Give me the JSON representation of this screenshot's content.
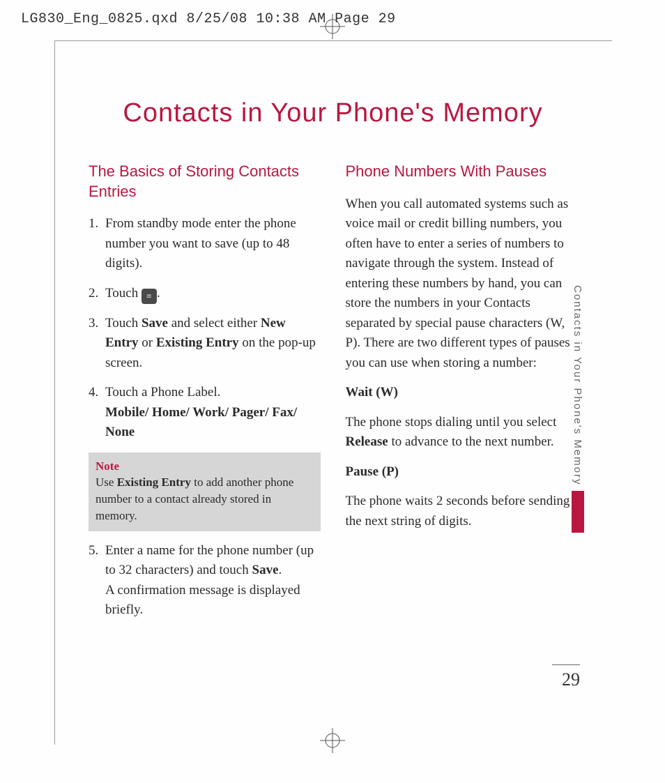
{
  "slug": "LG830_Eng_0825.qxd  8/25/08  10:38 AM  Page 29",
  "title": "Contacts in Your Phone's Memory",
  "left": {
    "heading": "The Basics of Storing Contacts Entries",
    "steps": {
      "s1": "From standby mode enter the phone number you want to save (up to 48 digits).",
      "s2a": "Touch ",
      "s2b": ".",
      "s3a": "Touch ",
      "s3_save": "Save",
      "s3b": " and select either ",
      "s3_new": "New Entry",
      "s3c": " or ",
      "s3_exist": "Existing Entry",
      "s3d": " on the pop-up screen.",
      "s4a": "Touch a Phone Label.",
      "s4b": "Mobile/ Home/ Work/ Pager/ Fax/ None",
      "s5a": "Enter a name for the phone number (up to 32 characters) and touch ",
      "s5_save": "Save",
      "s5b": ".",
      "s5c": "A confirmation message is displayed briefly."
    },
    "note": {
      "label": "Note",
      "a": "Use ",
      "bold": "Existing Entry",
      "b": " to add another phone number to a contact already stored in memory."
    }
  },
  "right": {
    "heading": "Phone Numbers With Pauses",
    "intro": "When you call automated systems such as voice mail or credit billing numbers, you often have to enter a series of numbers to navigate through the system. Instead of entering these numbers by hand, you can store the numbers in your Contacts separated by special pause characters (W, P). There are two different types of pauses you can use when storing a number:",
    "wait_h": "Wait (W)",
    "wait_a": "The phone stops dialing until you select ",
    "wait_bold": "Release",
    "wait_b": " to advance to the next number.",
    "pause_h": "Pause (P)",
    "pause_body": "The phone waits 2 seconds before sending the next string of digits."
  },
  "side_tab": "Contacts in Your Phone's Memory",
  "page_number": "29",
  "icon_glyph": "≡"
}
